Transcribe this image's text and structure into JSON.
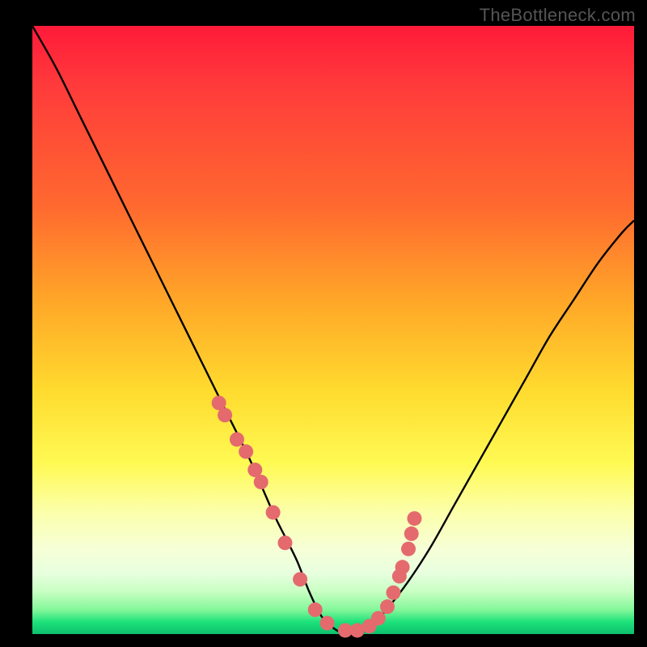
{
  "attribution": "TheBottleneck.com",
  "colors": {
    "frame": "#000000",
    "gradient_top": "#ff1a3a",
    "gradient_mid": "#ffdb2e",
    "gradient_low": "#fcffab",
    "gradient_bottom": "#0dbf6e",
    "curve_stroke": "#000000",
    "marker_fill": "#e46a6e",
    "marker_stroke": "#c94e55"
  },
  "chart_data": {
    "type": "line",
    "title": "",
    "xlabel": "",
    "ylabel": "",
    "xlim": [
      0,
      100
    ],
    "ylim": [
      0,
      100
    ],
    "grid": false,
    "series": [
      {
        "name": "bottleneck-curve",
        "x": [
          0,
          4,
          8,
          12,
          16,
          20,
          24,
          28,
          32,
          36,
          40,
          42,
          44,
          46,
          48,
          50,
          52,
          54,
          56,
          58,
          62,
          66,
          70,
          74,
          78,
          82,
          86,
          90,
          94,
          98,
          100
        ],
        "y": [
          100,
          93,
          85,
          77,
          69,
          61,
          53,
          45,
          37,
          29,
          20,
          16,
          12,
          7,
          3,
          1,
          0,
          0,
          1,
          3,
          8,
          14,
          21,
          28,
          35,
          42,
          49,
          55,
          61,
          66,
          68
        ]
      }
    ],
    "markers": {
      "name": "sample-points",
      "x": [
        31,
        32,
        34,
        35.5,
        37,
        38,
        40,
        42,
        44.5,
        47,
        49,
        52,
        54,
        56,
        57.5,
        59,
        60,
        61,
        61.5,
        62.5,
        63,
        63.5
      ],
      "y": [
        38,
        36,
        32,
        30,
        27,
        25,
        20,
        15,
        9,
        4,
        1.8,
        0.6,
        0.6,
        1.3,
        2.6,
        4.5,
        6.8,
        9.5,
        11,
        14,
        16.5,
        19
      ]
    }
  }
}
